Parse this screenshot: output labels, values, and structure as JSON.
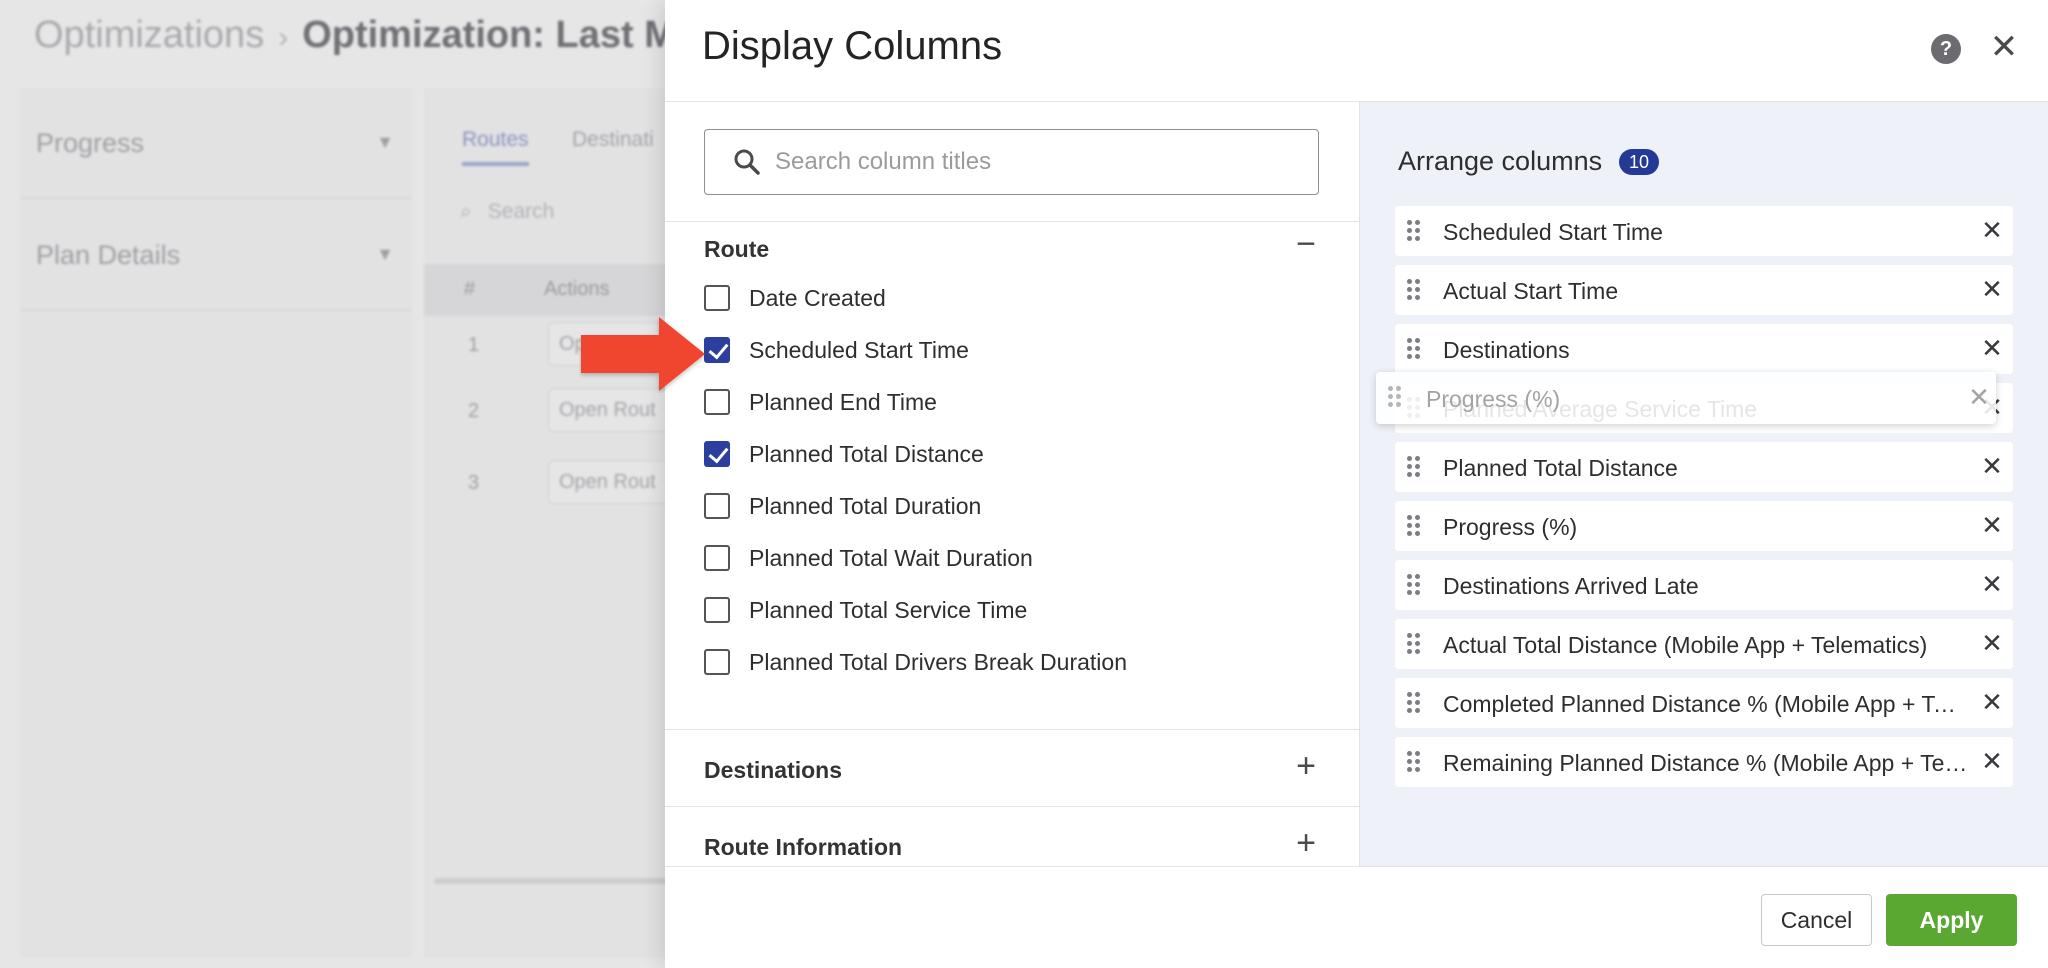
{
  "background": {
    "breadcrumb": {
      "root": "Optimizations",
      "current": "Optimization: Last M"
    },
    "sidebar": [
      {
        "label": "Progress"
      },
      {
        "label": "Plan Details"
      }
    ],
    "tabs": [
      {
        "label": "Routes",
        "active": true
      },
      {
        "label": "Destinati"
      }
    ],
    "search_placeholder": "Search",
    "table": {
      "headers": [
        "#",
        "Actions"
      ],
      "rows": [
        {
          "num": "1",
          "action": "Op"
        },
        {
          "num": "2",
          "action": "Open Rout"
        },
        {
          "num": "3",
          "action": "Open Rout"
        }
      ]
    }
  },
  "modal": {
    "title": "Display Columns",
    "search": {
      "placeholder": "Search column titles",
      "value": ""
    },
    "groups": [
      {
        "title": "Route",
        "expanded": true,
        "options": [
          {
            "label": "Date Created",
            "checked": false
          },
          {
            "label": "Scheduled Start Time",
            "checked": true
          },
          {
            "label": "Planned End Time",
            "checked": false
          },
          {
            "label": "Planned Total Distance",
            "checked": true
          },
          {
            "label": "Planned Total Duration",
            "checked": false
          },
          {
            "label": "Planned Total Wait Duration",
            "checked": false
          },
          {
            "label": "Planned Total Service Time",
            "checked": false
          },
          {
            "label": "Planned Total Drivers Break Duration",
            "checked": false
          }
        ]
      },
      {
        "title": "Destinations",
        "expanded": false
      },
      {
        "title": "Route Information",
        "expanded": false
      }
    ],
    "arrange": {
      "title": "Arrange columns",
      "count": "10",
      "columns": [
        "Scheduled Start Time",
        "Actual Start Time",
        "Destinations",
        "Planned Average Service Time",
        "Planned Total Distance",
        "Progress (%)",
        "Destinations Arrived Late",
        "Actual Total Distance (Mobile App + Telematics)",
        "Completed Planned Distance % (Mobile App + Telematics)",
        "Remaining Planned Distance % (Mobile App + Telematics)"
      ],
      "dragging": "Progress (%)"
    },
    "footer": {
      "cancel_label": "Cancel",
      "apply_label": "Apply"
    }
  },
  "colors": {
    "accent": "#2d3f9e",
    "badge": "#243a96",
    "apply": "#5aa832",
    "annotation_arrow": "#f0452f",
    "arrange_bg": "#eef2f8"
  }
}
